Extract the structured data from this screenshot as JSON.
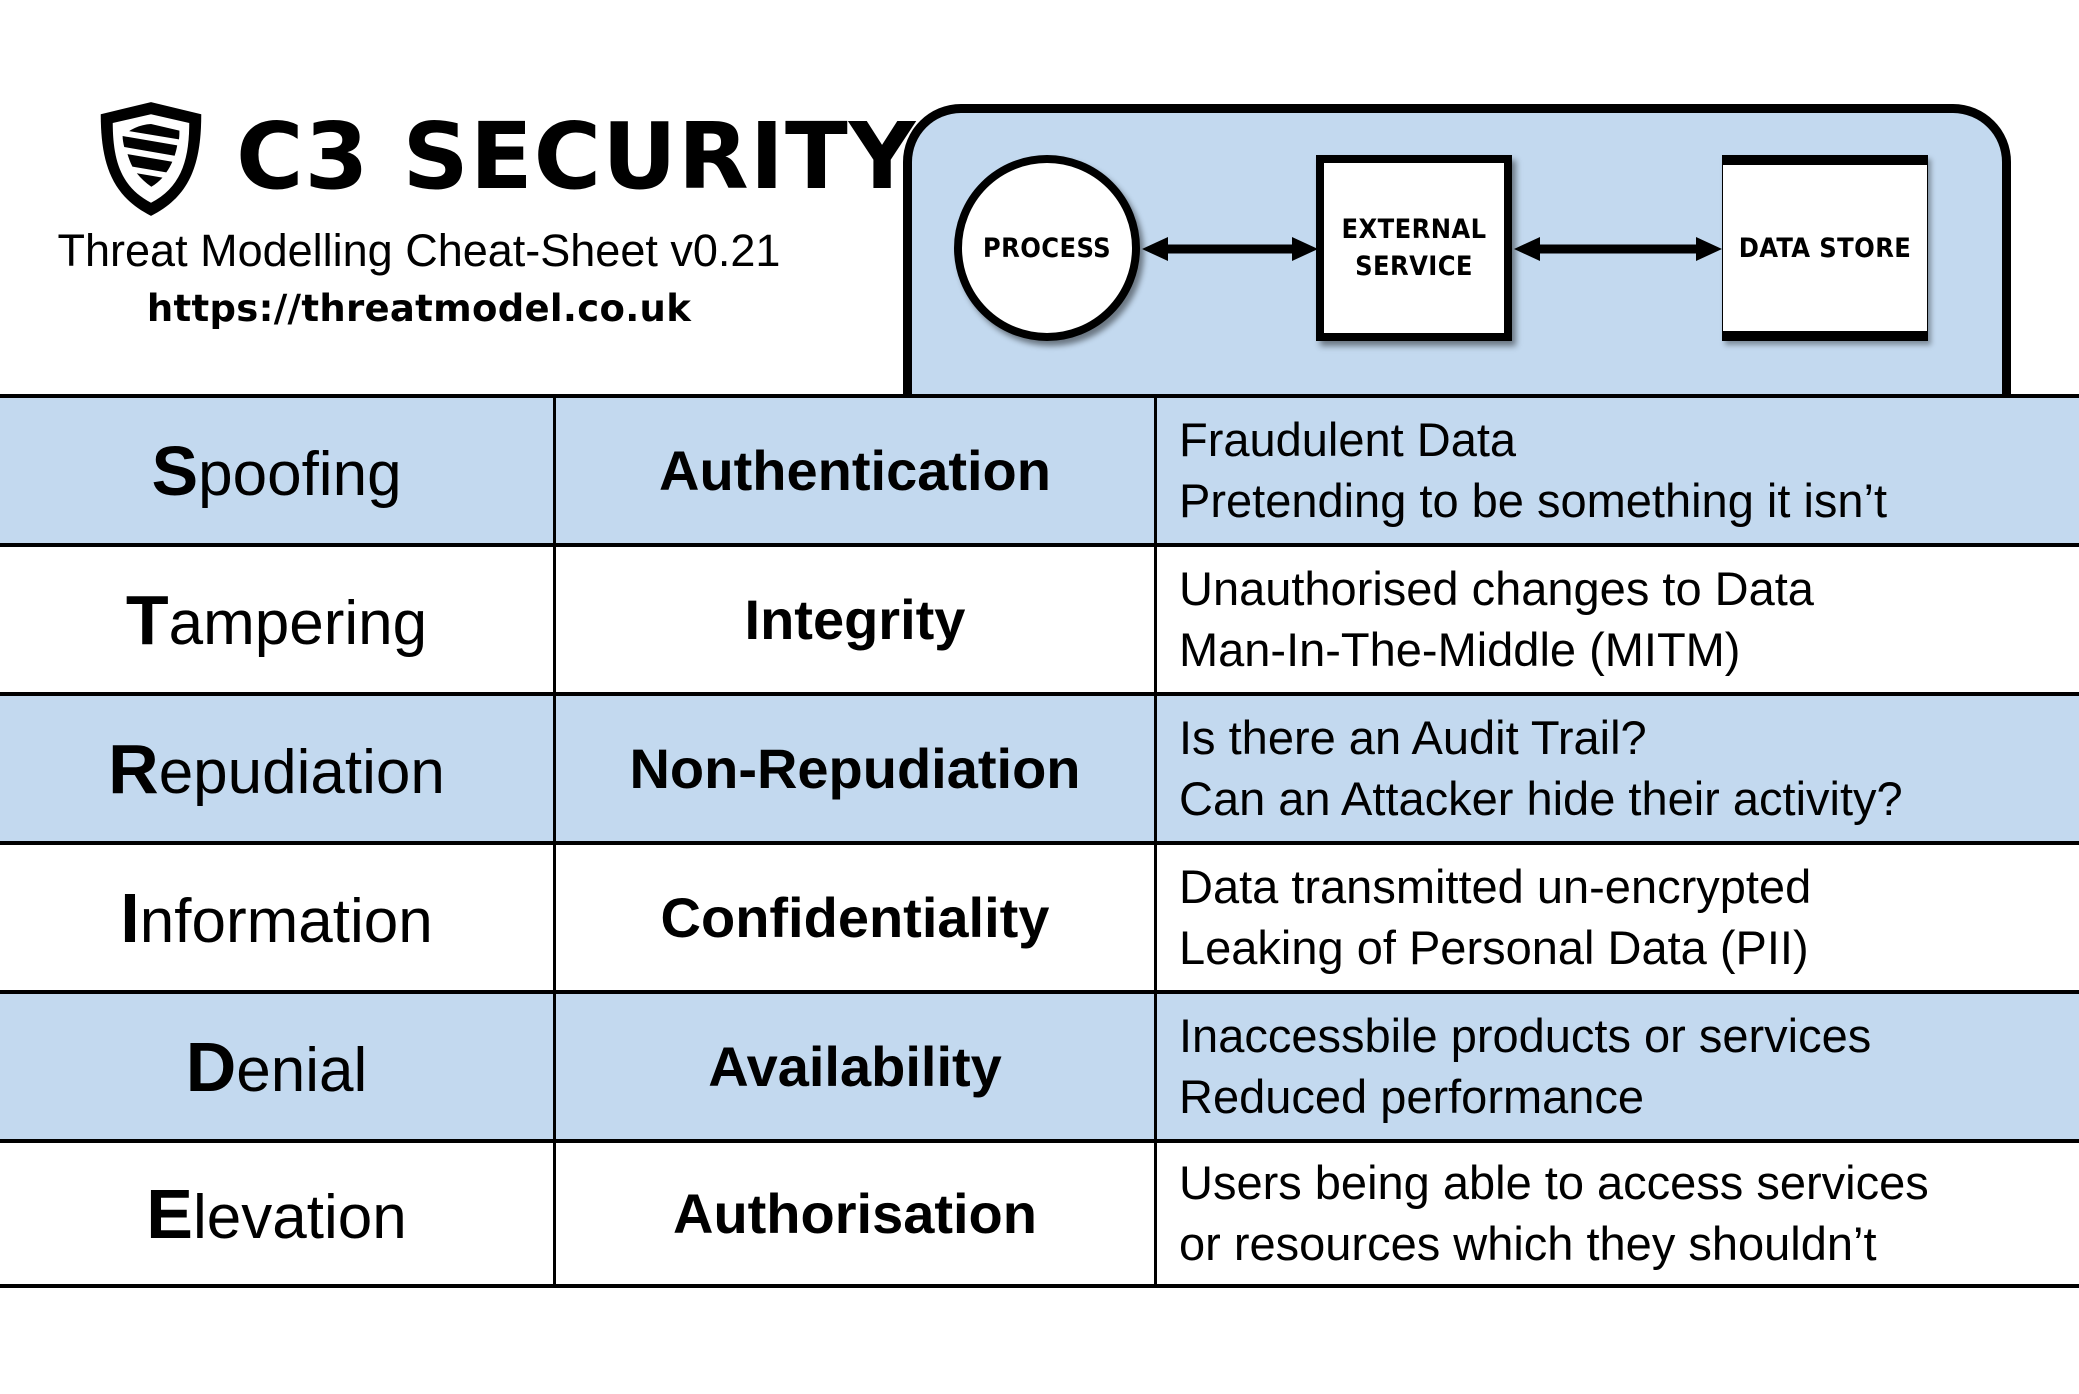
{
  "brand": {
    "logo_icon": "shield-s-logo-icon",
    "name": "C3 SECURITY",
    "tagline": "Threat Modelling Cheat-Sheet v0.21",
    "url": "https://threatmodel.co.uk"
  },
  "colors": {
    "row_shade": "#c3d9ef",
    "boundary_fill": "#c3d9ef",
    "line": "#000000",
    "node_fill": "#ffffff"
  },
  "diagram": {
    "nodes": [
      {
        "id": "process",
        "label": "PROCESS",
        "shape": "circle"
      },
      {
        "id": "external-service",
        "label": "EXTERNAL\nSERVICE",
        "label_line1": "EXTERNAL",
        "label_line2": "SERVICE",
        "shape": "rectangle"
      },
      {
        "id": "data-store",
        "label": "DATA STORE",
        "shape": "data-store"
      }
    ],
    "flows": [
      {
        "from": "process",
        "to": "external-service",
        "direction": "bidirectional"
      },
      {
        "from": "external-service",
        "to": "data-store",
        "direction": "bidirectional"
      }
    ]
  },
  "table": {
    "rows": [
      {
        "initial": "S",
        "rest": "poofing",
        "property": "Authentication",
        "desc_line1": "Fraudulent Data",
        "desc_line2": "Pretending to be something it isn’t",
        "shaded": true
      },
      {
        "initial": "T",
        "rest": "ampering",
        "property": "Integrity",
        "desc_line1": "Unauthorised changes to Data",
        "desc_line2": "Man-In-The-Middle (MITM)",
        "shaded": false
      },
      {
        "initial": "R",
        "rest": "epudiation",
        "property": "Non-Repudiation",
        "desc_line1": "Is there an Audit Trail?",
        "desc_line2": "Can an Attacker hide their activity?",
        "shaded": true
      },
      {
        "initial": "I",
        "rest": "nformation",
        "property": "Confidentiality",
        "desc_line1": "Data transmitted un-encrypted",
        "desc_line2": "Leaking of Personal Data (PII)",
        "shaded": false
      },
      {
        "initial": "D",
        "rest": "enial",
        "property": "Availability",
        "desc_line1": "Inaccessbile products or services",
        "desc_line2": "Reduced performance",
        "shaded": true
      },
      {
        "initial": "E",
        "rest": "levation",
        "property": "Authorisation",
        "desc_line1": "Users being able to access services",
        "desc_line2": "or resources which they shouldn’t",
        "shaded": false
      }
    ]
  }
}
